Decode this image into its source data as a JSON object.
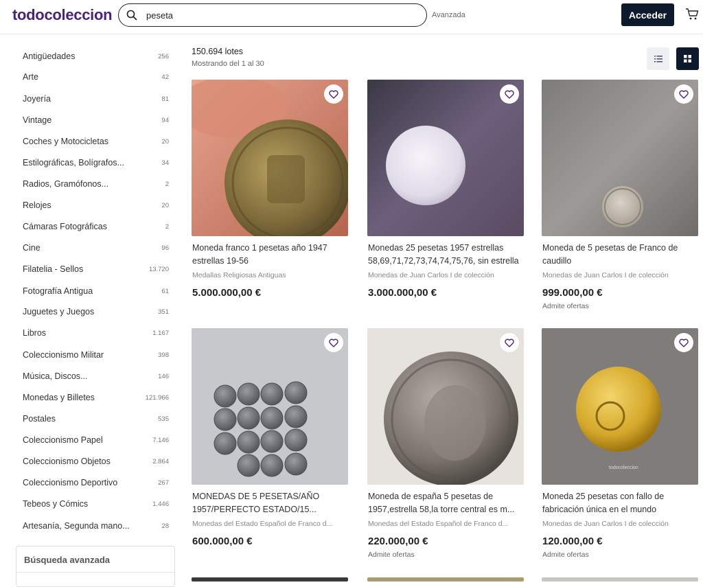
{
  "header": {
    "logo": "todocoleccion",
    "search_value": "peseta",
    "advanced_link": "Avanzada",
    "login_button": "Acceder"
  },
  "sidebar": {
    "categories": [
      {
        "name": "Antigüedades",
        "count": "256"
      },
      {
        "name": "Arte",
        "count": "42"
      },
      {
        "name": "Joyería",
        "count": "81"
      },
      {
        "name": "Vintage",
        "count": "94"
      },
      {
        "name": "Coches y Motocicletas",
        "count": "20"
      },
      {
        "name": "Estilográficas, Bolígrafos...",
        "count": "34"
      },
      {
        "name": "Radios, Gramófonos...",
        "count": "2"
      },
      {
        "name": "Relojes",
        "count": "20"
      },
      {
        "name": "Cámaras Fotográficas",
        "count": "2"
      },
      {
        "name": "Cine",
        "count": "96"
      },
      {
        "name": "Filatelia - Sellos",
        "count": "13.720"
      },
      {
        "name": "Fotografía Antigua",
        "count": "61"
      },
      {
        "name": "Juguetes y Juegos",
        "count": "351"
      },
      {
        "name": "Libros",
        "count": "1.167"
      },
      {
        "name": "Coleccionismo Militar",
        "count": "398"
      },
      {
        "name": "Música, Discos...",
        "count": "146"
      },
      {
        "name": "Monedas y Billetes",
        "count": "121.966"
      },
      {
        "name": "Postales",
        "count": "535"
      },
      {
        "name": "Coleccionismo Papel",
        "count": "7.146"
      },
      {
        "name": "Coleccionismo Objetos",
        "count": "2.864"
      },
      {
        "name": "Coleccionismo Deportivo",
        "count": "267"
      },
      {
        "name": "Tebeos y Cómics",
        "count": "1.446"
      },
      {
        "name": "Artesanía, Segunda mano...",
        "count": "28"
      }
    ],
    "advanced_search": "Búsqueda avanzada"
  },
  "results": {
    "total": "150.694 lotes",
    "showing": "Mostrando del 1 al 30"
  },
  "products": [
    {
      "title": "Moneda franco 1 pesetas año 1947 estrellas 19-56",
      "category": "Medallas Religiosas Antiguas",
      "price": "5.000.000,00 €",
      "offer": ""
    },
    {
      "title": "Monedas 25 pesetas 1957 estrellas 58,69,71,72,73,74,74,75,76, sin estrella",
      "category": "Monedas de Juan Carlos I de colección",
      "price": "3.000.000,00 €",
      "offer": ""
    },
    {
      "title": "Moneda de 5 pesetas de Franco de caudillo",
      "category": "Monedas de Juan Carlos I de colección",
      "price": "999.000,00 €",
      "offer": "Admite ofertas"
    },
    {
      "title": "MONEDAS DE 5 PESETAS/AÑO 1957/PERFECTO ESTADO/15...",
      "category": "Monedas del Estado Español de Franco d...",
      "price": "600.000,00 €",
      "offer": ""
    },
    {
      "title": "Moneda de españa 5 pesetas de 1957,estrella 58,la torre central es m...",
      "category": "Monedas del Estado Español de Franco d...",
      "price": "220.000,00 €",
      "offer": "Admite ofertas"
    },
    {
      "title": "Moneda 25 pesetas con fallo de fabricación única en el mundo",
      "category": "Monedas de Juan Carlos I de colección",
      "price": "120.000,00 €",
      "offer": "Admite ofertas"
    }
  ],
  "watermark": "todocoleccion",
  "colors": {
    "brand": "#4a2377",
    "dark_button": "#0e1a2b"
  }
}
